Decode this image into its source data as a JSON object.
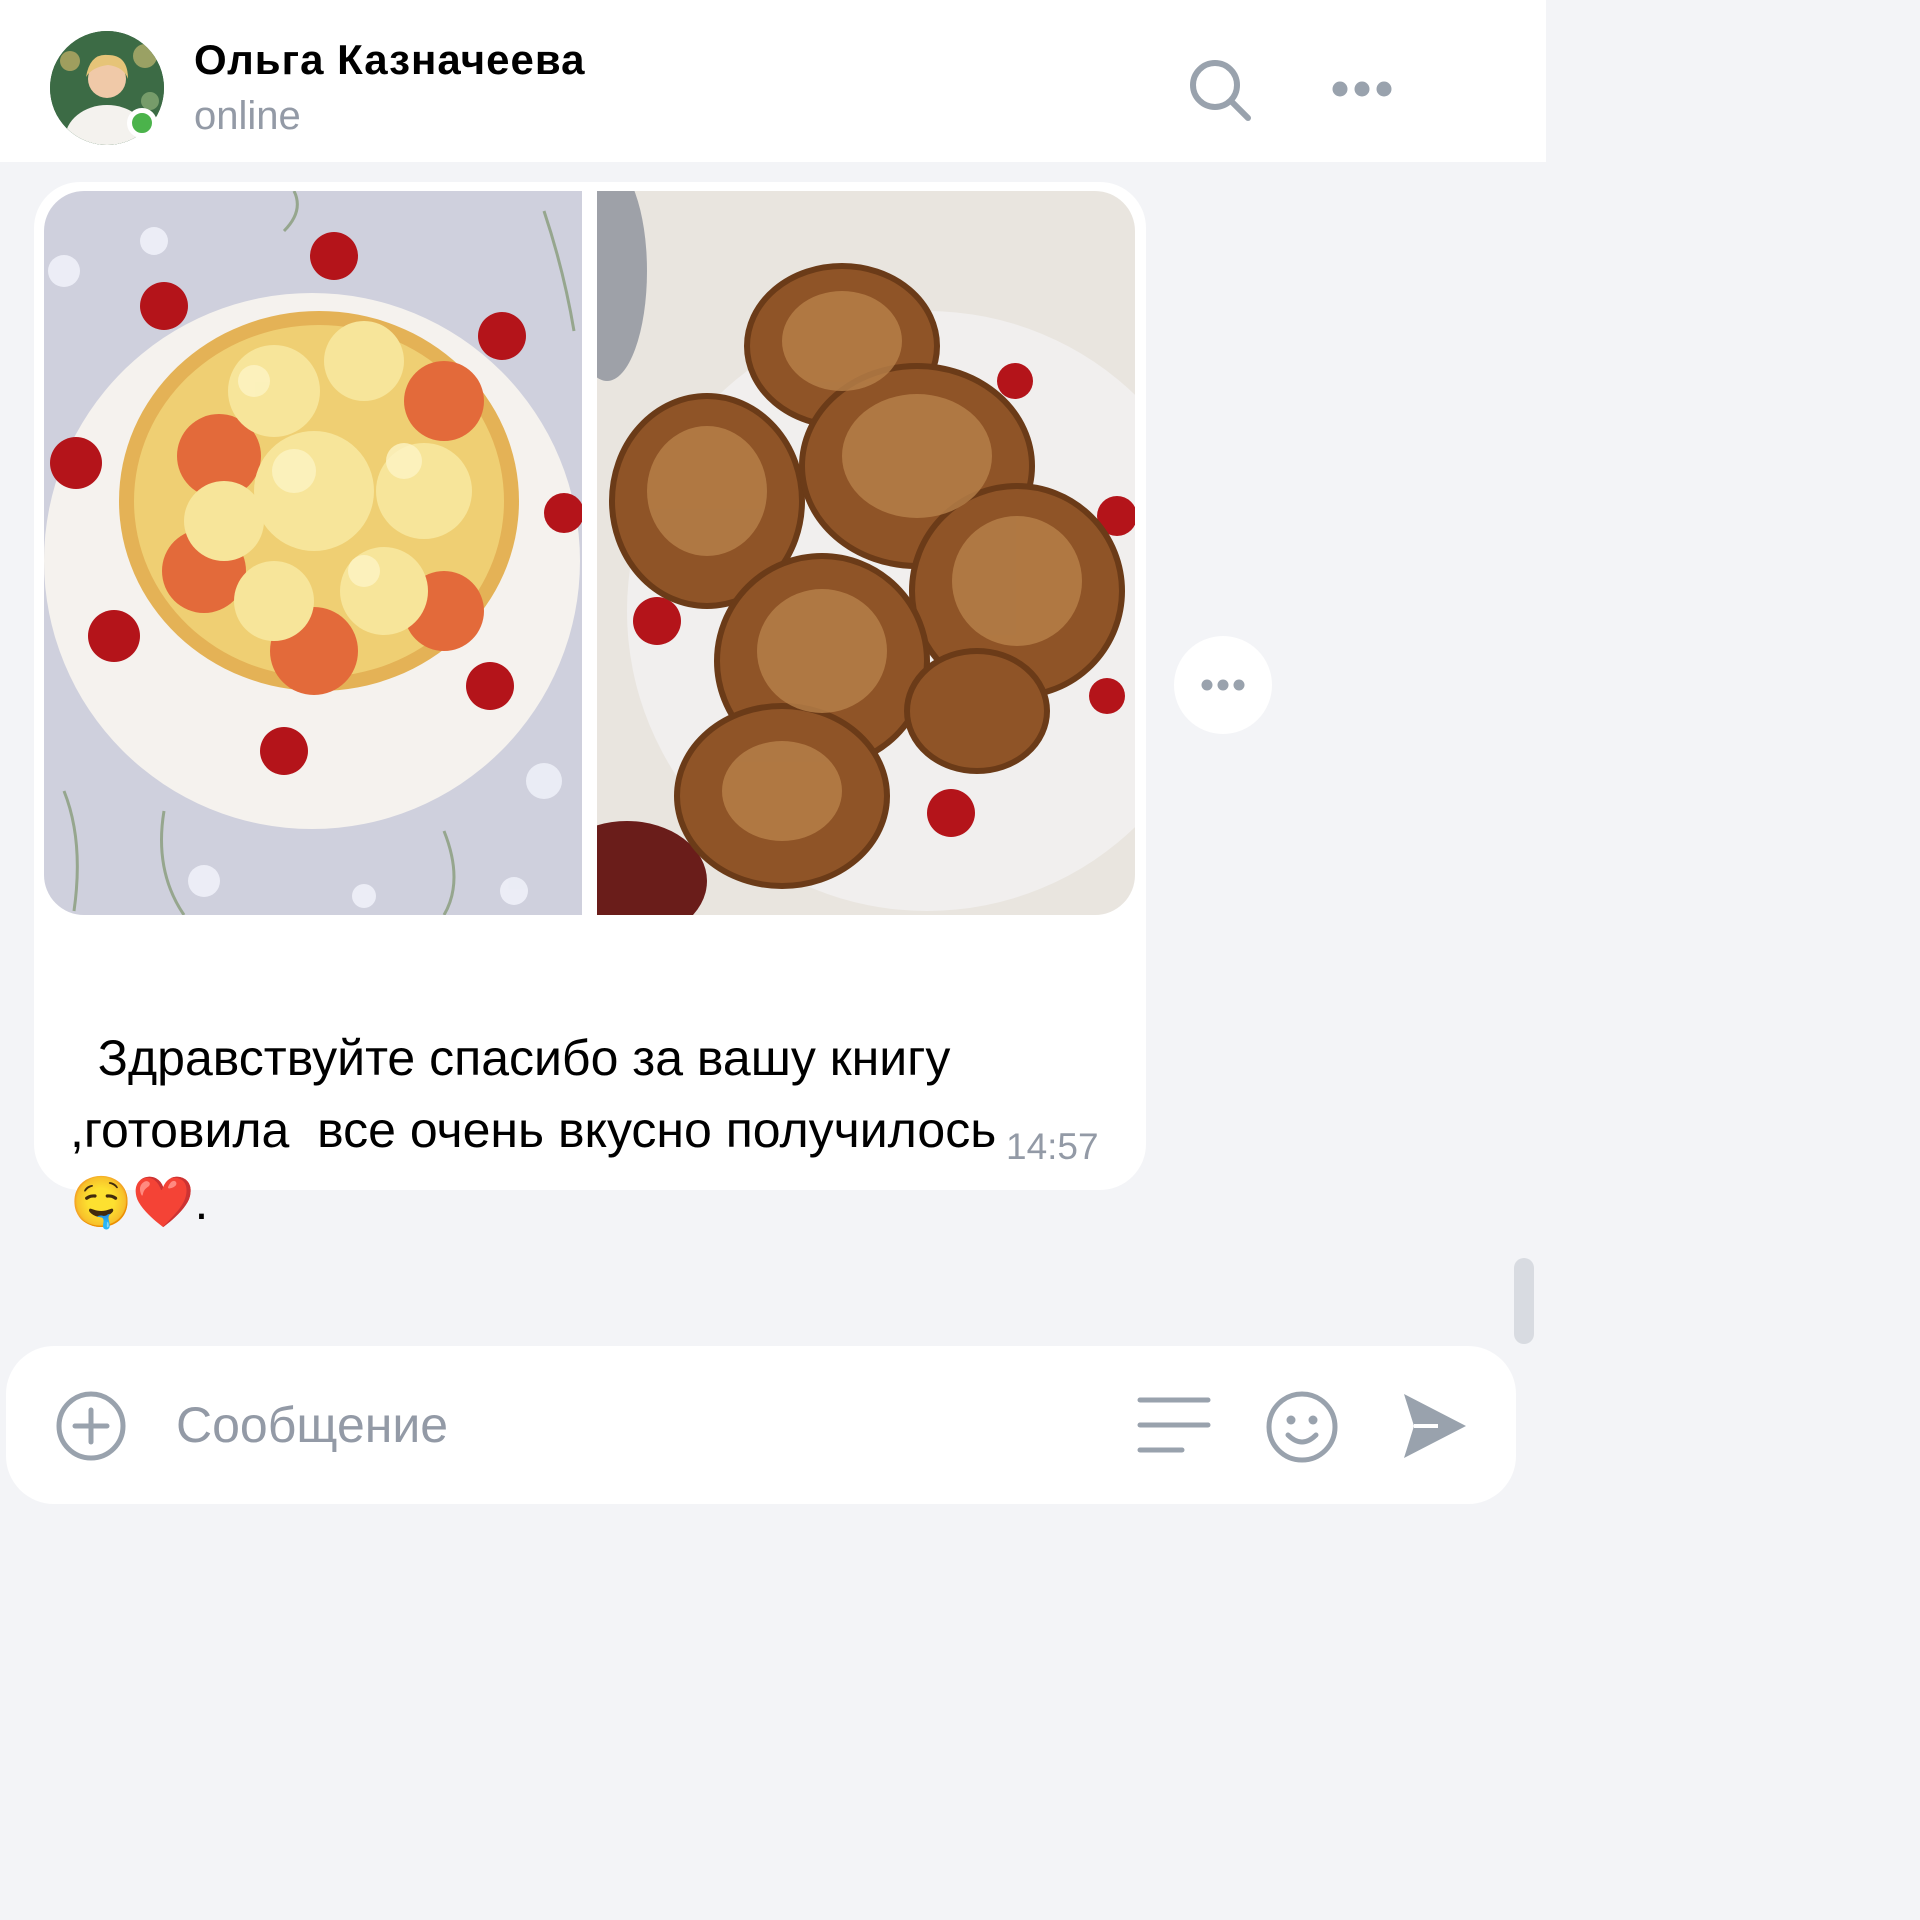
{
  "header": {
    "contact_name": "Ольга Казначеева",
    "status": "online",
    "icons": [
      "search-icon",
      "more-icon"
    ],
    "online_indicator_color": "#4bb34b"
  },
  "message": {
    "photos": [
      "dish-photo",
      "pies-photo"
    ],
    "text": "Здравствуйте спасибо за вашу книгу\n,готовила  все очень вкусно получилось",
    "emoji": "🤤❤️.",
    "time": "14:57"
  },
  "composer": {
    "placeholder": "Сообщение",
    "icons": [
      "add-attachment-icon",
      "menu-lines-icon",
      "emoji-icon",
      "send-icon"
    ]
  },
  "colors": {
    "background": "#f3f4f7",
    "bubble": "#ffffff",
    "secondary_text": "#939aa6",
    "icon": "#99a2ad",
    "online": "#4bb34b"
  }
}
